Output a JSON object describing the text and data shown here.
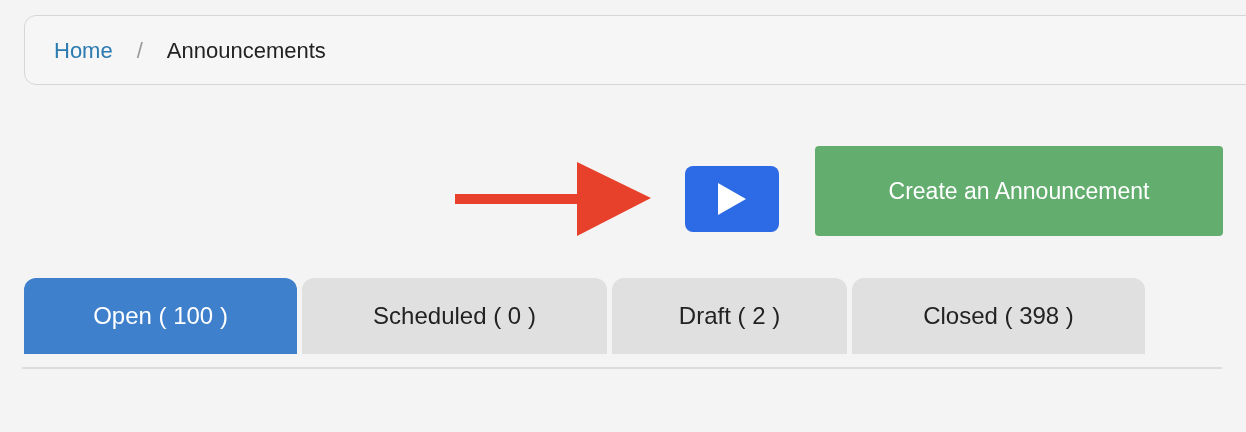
{
  "breadcrumb": {
    "items": [
      {
        "label": "Home",
        "kind": "link"
      },
      {
        "label": "Announcements",
        "kind": "current"
      }
    ],
    "separator": "/"
  },
  "actions": {
    "play_button": {
      "kind": "play"
    },
    "create_button": "Create an Announcement"
  },
  "tabs": [
    {
      "label": "Open ( 100 )",
      "selected": true
    },
    {
      "label": "Scheduled ( 0 )",
      "selected": false
    },
    {
      "label": "Draft ( 2 )",
      "selected": false
    },
    {
      "label": "Closed ( 398 )",
      "selected": false
    }
  ]
}
